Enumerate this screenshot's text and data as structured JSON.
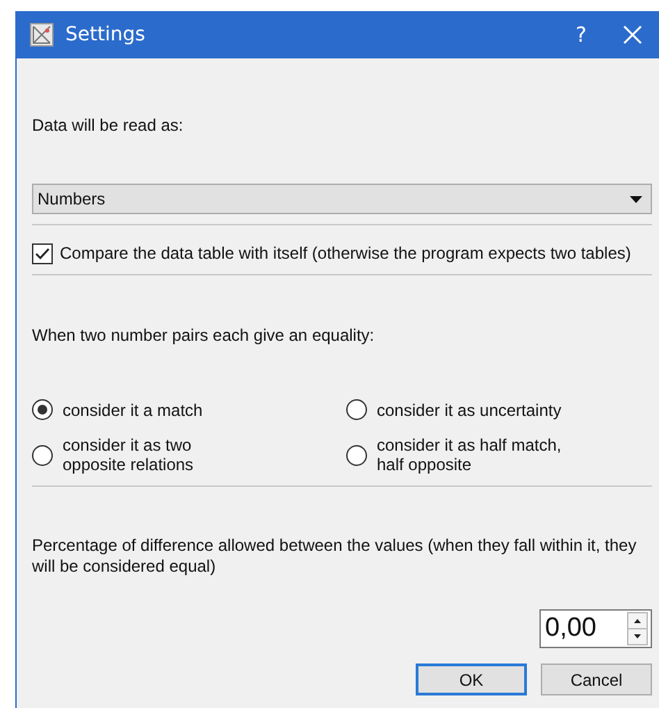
{
  "window": {
    "title": "Settings",
    "help": "?"
  },
  "read_as": {
    "label": "Data will be read as:",
    "dropdown": {
      "value": "Numbers"
    }
  },
  "self_compare": {
    "label": "Compare the data table with itself (otherwise the program expects two tables)",
    "checked": true
  },
  "equality": {
    "label": "When two number pairs each give an equality:",
    "options": [
      {
        "label": "consider it a match",
        "selected": true
      },
      {
        "label": "consider it as uncertainty",
        "selected": false
      },
      {
        "label": "consider it as two\nopposite relations",
        "selected": false
      },
      {
        "label": "consider it as half match,\nhalf opposite",
        "selected": false
      }
    ]
  },
  "tolerance": {
    "label": "Percentage of difference allowed between the values (when they fall within it, they will be considered equal)",
    "value": "0,00"
  },
  "buttons": [
    {
      "label": "OK",
      "default": true
    },
    {
      "label": "Cancel",
      "default": false
    }
  ]
}
